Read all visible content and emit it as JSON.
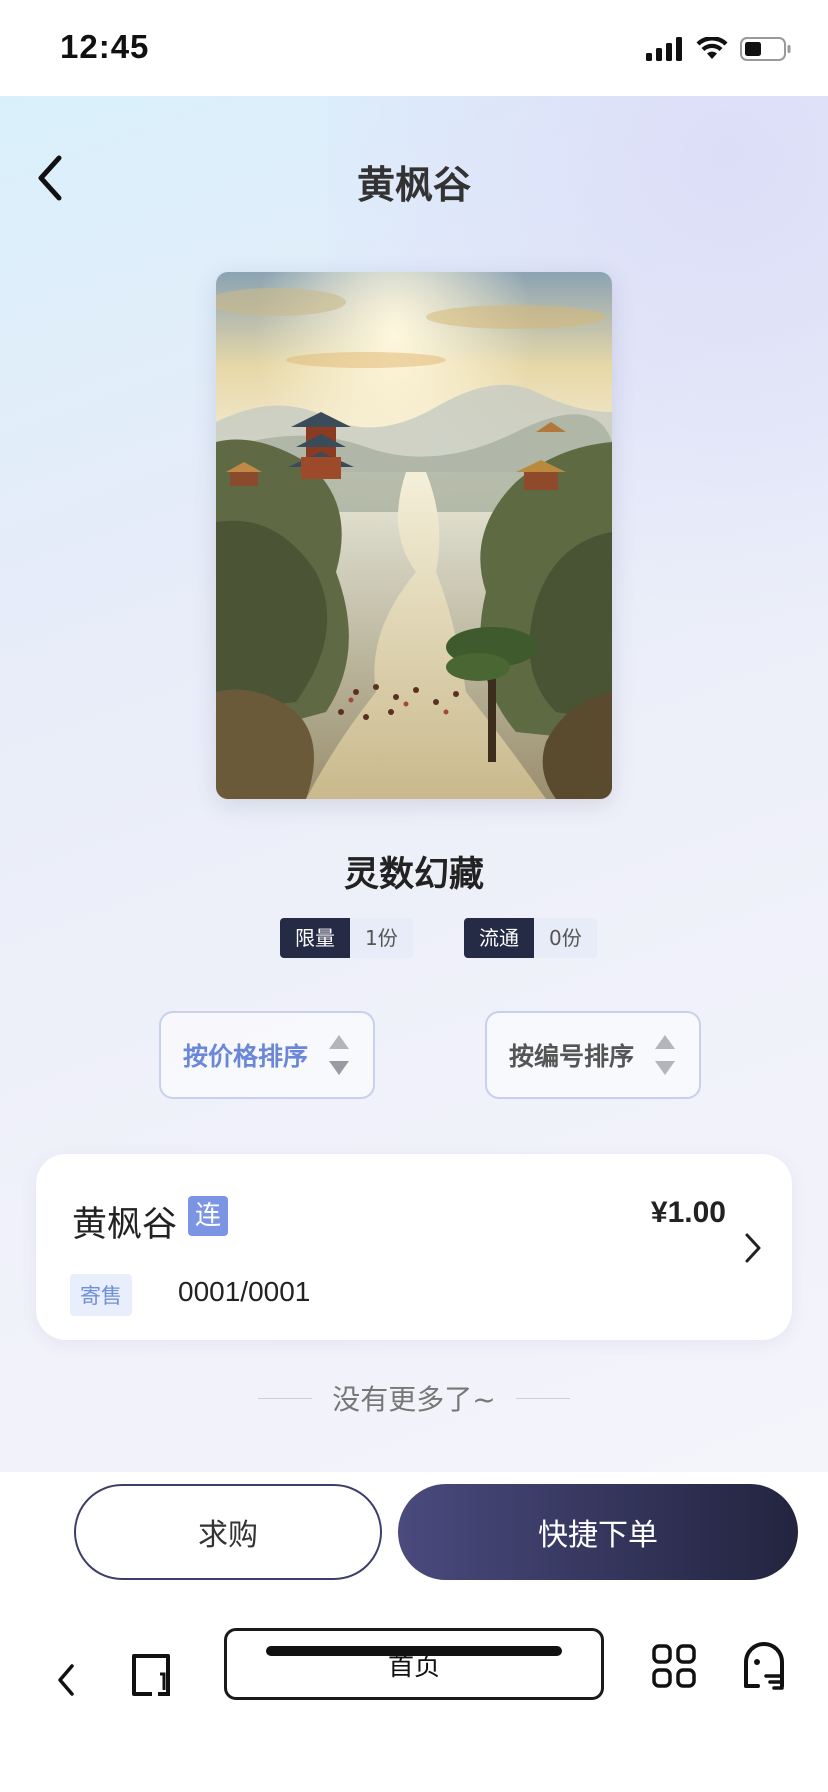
{
  "status_bar": {
    "time": "12:45"
  },
  "header": {
    "title": "黄枫谷"
  },
  "collection": {
    "name": "灵数幻藏",
    "tags": [
      {
        "label": "限量",
        "value": "1份"
      },
      {
        "label": "流通",
        "value": "0份"
      }
    ]
  },
  "sort": {
    "by_price": {
      "label": "按价格排序",
      "color": "#6b87d9"
    },
    "by_number": {
      "label": "按编号排序",
      "color": "#555555"
    }
  },
  "listings": [
    {
      "title": "黄枫谷",
      "chain_badge": "连",
      "price": "¥1.00",
      "status": "寄售",
      "serial": "0001/0001"
    }
  ],
  "end_text": "没有更多了~",
  "actions": {
    "ask_label": "求购",
    "quick_order_label": "快捷下单"
  },
  "browser": {
    "address_label": "首页"
  },
  "colors": {
    "accent": "#252a45",
    "link_blue": "#6b87d9",
    "badge_blue": "#7b95e4"
  }
}
